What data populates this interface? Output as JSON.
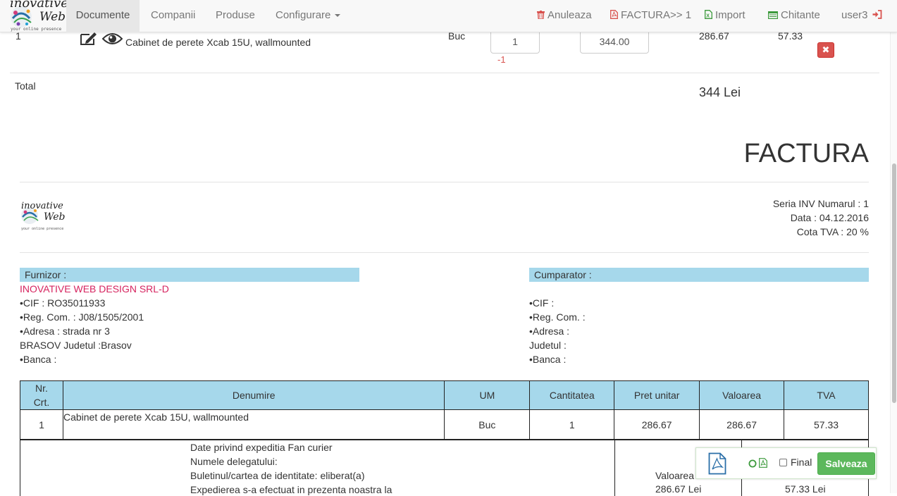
{
  "navbar": {
    "logo": {
      "line1": "inovative",
      "line2": "Web",
      "tagline": "your online presence"
    },
    "items": [
      {
        "label": "Documente"
      },
      {
        "label": "Companii"
      },
      {
        "label": "Produse"
      },
      {
        "label": "Configurare"
      }
    ],
    "actions": [
      {
        "label": "Anuleaza",
        "icon": "trash-icon"
      },
      {
        "label": "FACTURA>> 1",
        "icon": "pdf-icon"
      },
      {
        "label": "Import",
        "icon": "excel-icon"
      },
      {
        "label": "Chitante",
        "icon": "list-icon"
      },
      {
        "label": "user3",
        "icon": "logout-icon"
      }
    ],
    "colors": {
      "action_red": "#d9534f",
      "action_green": "#3c9a3c"
    }
  },
  "edit_row": {
    "nr": "1",
    "product": "Cabinet de perete Xcab 15U, wallmounted",
    "um": "Buc",
    "qty": "1",
    "qty_delta": "-1",
    "price": "344.00",
    "unit_net": "286.67",
    "vat": "57.33"
  },
  "total": {
    "label": "Total",
    "value": "344 Lei"
  },
  "invoice": {
    "title": "FACTURA",
    "meta": {
      "serie": "Seria INV Numarul : 1",
      "data": "Data : 04.12.2016",
      "cota": "Cota TVA : 20 %"
    },
    "furnizor": {
      "header": "Furnizor :",
      "name": "INOVATIVE WEB DESIGN SRL-D",
      "cif": "•CIF : RO35011933",
      "reg": "•Reg. Com. : J08/1505/2001",
      "adresa": "•Adresa : strada nr 3",
      "oras": "BRASOV Judetul :Brasov",
      "banca": "•Banca :"
    },
    "cumparator": {
      "header": "Cumparator :",
      "cif": "•CIF :",
      "reg": "•Reg. Com. :",
      "adresa": "•Adresa :",
      "judet": "Judetul :",
      "banca": "•Banca :"
    },
    "table": {
      "headers": {
        "nr": "Nr.",
        "crt": "Crt.",
        "denumire": "Denumire",
        "um": "UM",
        "cant": "Cantitatea",
        "pret": "Pret unitar",
        "valoare": "Valoarea",
        "tva": "TVA"
      },
      "rows": [
        {
          "nr": "1",
          "denumire": "Cabinet de perete Xcab 15U, wallmounted",
          "um": "Buc",
          "cant": "1",
          "pret": "286.67",
          "valoare": "286.67",
          "tva": "57.33"
        }
      ]
    },
    "expeditie": {
      "l1": "Date privind expeditia Fan curier",
      "l2": "Numele delegatului:",
      "l3": "Buletinul/cartea de identitate: eliberat(a)",
      "l4": "Expedierea s-a efectuat in prezenta noastra la"
    },
    "totals": {
      "label": "Valoarea",
      "valoare": "286.67 Lei",
      "tva": "57.33 Lei"
    }
  },
  "floatbar": {
    "final_label": "Final",
    "save_label": "Salveaza"
  }
}
